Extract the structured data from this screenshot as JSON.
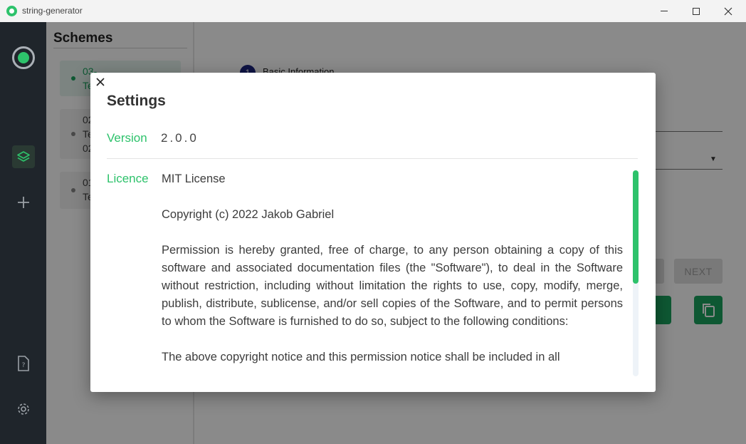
{
  "window": {
    "title": "string-generator",
    "minimize_label": "",
    "maximize_label": "",
    "close_label": "×"
  },
  "colors": {
    "accent": "#2dc26b",
    "rail_bg": "#1f252b",
    "step_badge": "#1a237e"
  },
  "rail": {
    "icons": [
      "app-logo-icon",
      "layers-icon",
      "plus-icon",
      "help-document-icon",
      "gear-icon"
    ]
  },
  "schemes": {
    "title": "Schemes",
    "items": [
      {
        "line1": "03-",
        "line2": "Te",
        "active": true
      },
      {
        "line1": "02",
        "line2": "Te",
        "line3": "02",
        "active": false
      },
      {
        "line1": "01",
        "line2": "Te",
        "active": false
      }
    ]
  },
  "main": {
    "step_number": "1",
    "step_label": "Basic Information",
    "next_label": "NEXT",
    "bottom_text": "......."
  },
  "dialog": {
    "title": "Settings",
    "version_label": "Version",
    "version_value": "2.0.0",
    "licence_label": "Licence",
    "licence_paragraphs": [
      "MIT License",
      "Copyright (c) 2022 Jakob Gabriel",
      "Permission is hereby granted, free of charge, to any person obtaining a copy of this software and associated documentation files (the \"Software\"), to deal in the Software without restriction, including without limitation the rights to use, copy, modify, merge, publish, distribute, sublicense, and/or sell copies of the Software, and to permit persons to whom the Software is furnished to do so, subject to the following conditions:",
      "The above copyright notice and this permission notice shall be included in all"
    ],
    "scroll_position": 0.0,
    "scroll_visible_fraction": 0.55
  }
}
